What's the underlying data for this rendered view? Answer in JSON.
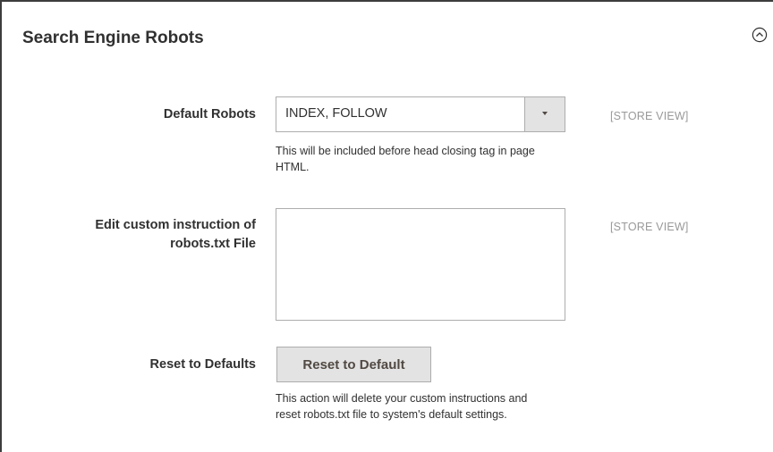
{
  "section": {
    "title": "Search Engine Robots",
    "collapse_icon": "chevron-up-circle-icon"
  },
  "fields": {
    "default_robots": {
      "label": "Default Robots",
      "value": "INDEX, FOLLOW",
      "note": "This will be included before head closing tag in page HTML.",
      "scope": "[STORE VIEW]",
      "arrow_icon": "caret-down-icon"
    },
    "custom_instruction": {
      "label_line1": "Edit custom instruction of",
      "label_line2": "robots.txt File",
      "value": "",
      "scope": "[STORE VIEW]"
    },
    "reset": {
      "label": "Reset to Defaults",
      "button_label": "Reset to Default",
      "note": "This action will delete your custom instructions and reset robots.txt file to system's default settings."
    }
  }
}
